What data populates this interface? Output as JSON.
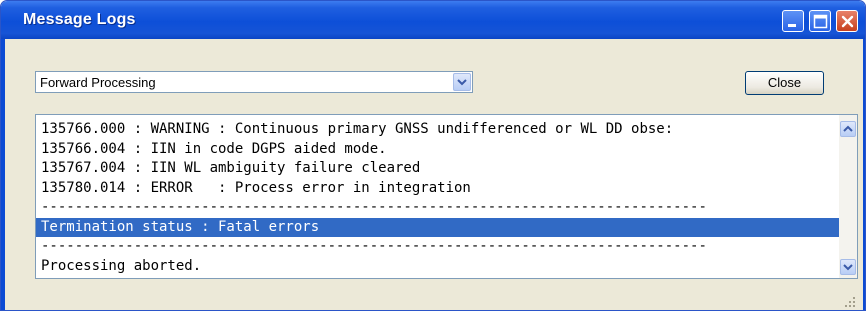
{
  "window": {
    "title": "Message Logs",
    "controls": [
      "minimize-icon",
      "maximize-icon",
      "close-icon"
    ]
  },
  "toolbar": {
    "combo_value": "Forward Processing",
    "close_label": "Close"
  },
  "log": {
    "lines": [
      "135766.000 : WARNING : Continuous primary GNSS undifferenced or WL DD obse:",
      "135766.004 : IIN in code DGPS aided mode.",
      "135767.004 : IIN WL ambiguity failure cleared",
      "135780.014 : ERROR   : Process error in integration",
      "-------------------------------------------------------------------------------",
      "Termination status : Fatal errors",
      "-------------------------------------------------------------------------------",
      "Processing aborted."
    ],
    "selected_line_index": 5
  },
  "colors": {
    "titlebar": "#0d4fd8",
    "selection": "#316ac5",
    "client_bg": "#ece9d8"
  }
}
